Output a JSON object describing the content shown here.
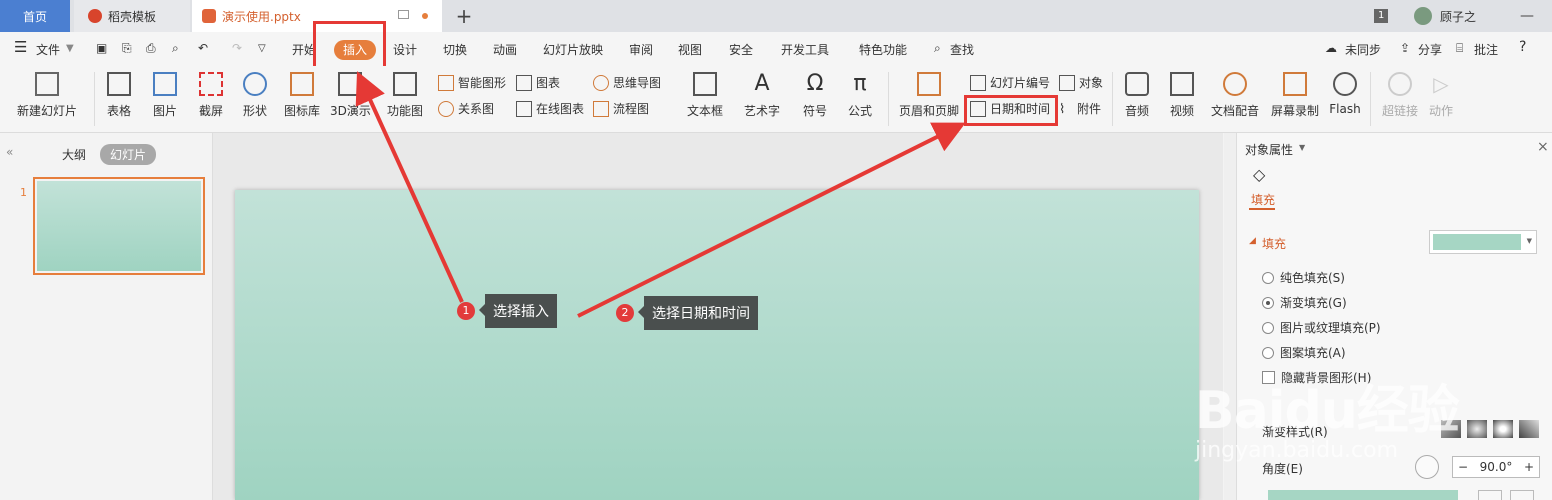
{
  "tabs": {
    "home": "首页",
    "template": "稻壳模板",
    "file": "演示使用.pptx",
    "add": "+"
  },
  "titlebar": {
    "badge": "1",
    "user": "顾子之",
    "min": "—"
  },
  "menu": {
    "file": "文件",
    "start": "开始",
    "insert": "插入",
    "design": "设计",
    "switch": "切换",
    "animation": "动画",
    "slideshow": "幻灯片放映",
    "review": "审阅",
    "view": "视图",
    "security": "安全",
    "devtools": "开发工具",
    "special": "特色功能",
    "search": "查找",
    "unsync": "未同步",
    "share": "分享",
    "comment": "批注",
    "help": "?"
  },
  "ribbon": {
    "new_slide": "新建幻灯片",
    "table": "表格",
    "picture": "图片",
    "screenshot": "截屏",
    "shape": "形状",
    "icon_lib": "图标库",
    "demo3d": "3D演示",
    "function_chart": "功能图",
    "smart_shape": "智能图形",
    "chart": "图表",
    "mindmap": "思维导图",
    "relation": "关系图",
    "online_chart": "在线图表",
    "flowchart": "流程图",
    "textbox": "文本框",
    "wordart": "艺术字",
    "symbol": "符号",
    "formula": "公式",
    "header_footer": "页眉和页脚",
    "slide_number": "幻灯片编号",
    "object": "对象",
    "datetime": "日期和时间",
    "attachment": "附件",
    "audio": "音频",
    "video": "视频",
    "doc_dub": "文档配音",
    "screen_rec": "屏幕录制",
    "flash": "Flash",
    "hyperlink": "超链接",
    "action": "动作"
  },
  "leftpane": {
    "outline": "大纲",
    "slides": "幻灯片",
    "slide_no": "1"
  },
  "rightpane": {
    "title": "对象属性",
    "tab_fill": "填充",
    "section_fill": "填充",
    "options": [
      "纯色填充(S)",
      "渐变填充(G)",
      "图片或纹理填充(P)",
      "图案填充(A)"
    ],
    "hide_bg": "隐藏背景图形(H)",
    "grad_style": "渐变样式(R)",
    "angle_label": "角度(E)",
    "angle_value": "90.0°",
    "minus": "−",
    "plus": "+"
  },
  "annotations": [
    {
      "num": "1",
      "text": "选择插入"
    },
    {
      "num": "2",
      "text": "选择日期和时间"
    }
  ],
  "watermark": {
    "logo": "Baidu经验",
    "url": "jingyan.baidu.com"
  },
  "colors": {
    "accent": "#e67e3c",
    "highlight": "#e53935",
    "slide_top": "#c2e2d8",
    "slide_bottom": "#9fd3c1"
  }
}
